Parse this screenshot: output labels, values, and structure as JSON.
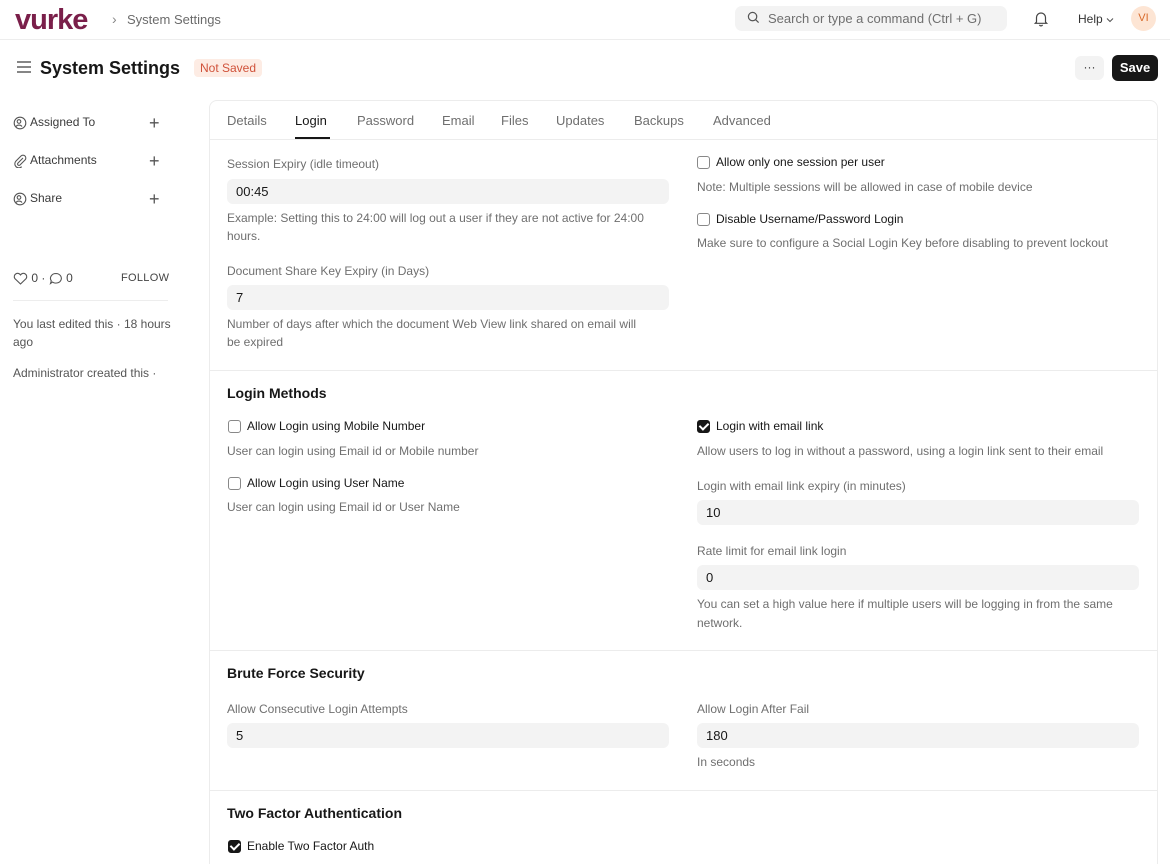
{
  "navbar": {
    "logo": "vurke",
    "breadcrumb": "System Settings",
    "search_placeholder": "Search or type a command (Ctrl + G)",
    "help_label": "Help",
    "avatar_initials": "VI"
  },
  "page": {
    "title": "System Settings",
    "status_badge": "Not Saved",
    "more_label": "···",
    "save_label": "Save"
  },
  "sidebar": {
    "items": [
      {
        "label": "Assigned To",
        "icon": "assign-icon"
      },
      {
        "label": "Attachments",
        "icon": "paperclip-icon"
      },
      {
        "label": "Share",
        "icon": "share-icon"
      }
    ],
    "likes_count": "0",
    "comments_count": "0",
    "follow_label": "FOLLOW",
    "last_edited": "You last edited this · 18 hours ago",
    "created_by": "Administrator created this ·"
  },
  "tabs": [
    "Details",
    "Login",
    "Password",
    "Email",
    "Files",
    "Updates",
    "Backups",
    "Advanced"
  ],
  "active_tab": "Login",
  "session": {
    "session_expiry_label": "Session Expiry (idle timeout)",
    "session_expiry_value": "00:45",
    "session_expiry_desc_1": "Example: Setting this to 24:00 will log out a user if they are not active for 24:00",
    "session_expiry_desc_2": "hours.",
    "share_key_label": "Document Share Key Expiry (in Days)",
    "share_key_value": "7",
    "share_key_desc_1": "Number of days after which the document Web View link shared on email will",
    "share_key_desc_2": "be expired",
    "one_session_label": "Allow only one session per user",
    "one_session_checked": false,
    "one_session_note": "Note: Multiple sessions will be allowed in case of mobile device",
    "disable_pwd_label": "Disable Username/Password Login",
    "disable_pwd_checked": false,
    "disable_pwd_note": "Make sure to configure a Social Login Key before disabling to prevent lockout"
  },
  "login_methods": {
    "title": "Login Methods",
    "mobile_label": "Allow Login using Mobile Number",
    "mobile_checked": false,
    "mobile_desc": "User can login using Email id or Mobile number",
    "username_label": "Allow Login using User Name",
    "username_checked": false,
    "username_desc": "User can login using Email id or User Name",
    "email_link_label": "Login with email link",
    "email_link_checked": true,
    "email_link_desc": "Allow users to log in without a password, using a login link sent to their email",
    "email_link_expiry_label": "Login with email link expiry (in minutes)",
    "email_link_expiry_value": "10",
    "rate_limit_label": "Rate limit for email link login",
    "rate_limit_value": "0",
    "rate_limit_desc_1": "You can set a high value here if multiple users will be logging in from the same",
    "rate_limit_desc_2": "network."
  },
  "brute_force": {
    "title": "Brute Force Security",
    "attempts_label": "Allow Consecutive Login Attempts",
    "attempts_value": "5",
    "after_fail_label": "Allow Login After Fail",
    "after_fail_value": "180",
    "after_fail_desc": "In seconds"
  },
  "two_factor": {
    "title": "Two Factor Authentication",
    "enable_label": "Enable Two Factor Auth",
    "enable_checked": true
  }
}
